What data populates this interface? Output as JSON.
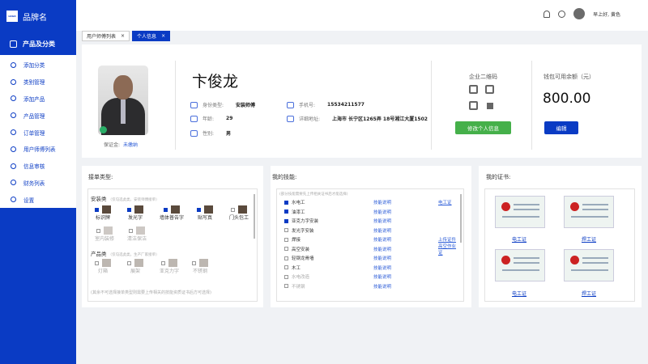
{
  "brand": {
    "logo": "LOGO",
    "name": "品牌名"
  },
  "sidebar": {
    "category": "产品及分类",
    "items": [
      {
        "label": "添加分类",
        "icon": "user-icon"
      },
      {
        "label": "类别管理",
        "icon": "list-icon"
      },
      {
        "label": "添加产品",
        "icon": "plus-icon"
      },
      {
        "label": "产品管理",
        "icon": "box-icon"
      },
      {
        "label": "订单管理",
        "icon": "order-icon"
      },
      {
        "label": "用户师傅列表",
        "icon": "users-icon"
      },
      {
        "label": "信息审核",
        "icon": "check-icon"
      },
      {
        "label": "财务列表",
        "icon": "finance-icon"
      },
      {
        "label": "设置",
        "icon": "gear-icon"
      }
    ]
  },
  "header": {
    "greeting": "早上好, 黄色"
  },
  "tabs": [
    {
      "label": "用户师傅列表"
    },
    {
      "label": "个人信息"
    }
  ],
  "profile": {
    "name": "卞俊龙",
    "guarantor_label": "保证金:",
    "guarantor_value": "未缴纳",
    "fields": {
      "type_label": "身份类型:",
      "type_value": "安装师傅",
      "age_label": "年龄:",
      "age_value": "29",
      "gender_label": "性别:",
      "gender_value": "男",
      "phone_label": "手机号:",
      "phone_value": "15534211577",
      "address_label": "详细地址:",
      "address_value": "上海市 长宁区1265弄 18号湘江大厦1502"
    },
    "qr_label": "企业二维码",
    "edit_info": "修改个人信息",
    "wallet_label": "钱包可用余额（元）",
    "balance": "800.00",
    "edit": "编辑"
  },
  "orders": {
    "title": "接单类型:",
    "install_label": "安装类",
    "install_hint": "（仅勾选此类，安装师傅接单）",
    "install_items": [
      {
        "label": "标识牌",
        "checked": true
      },
      {
        "label": "发光字",
        "checked": true
      },
      {
        "label": "墙体普告字",
        "checked": true
      },
      {
        "label": "贴写真",
        "checked": true
      },
      {
        "label": "门头包工",
        "checked": false
      },
      {
        "label": "室内装修",
        "checked": false
      },
      {
        "label": "清洁保洁",
        "checked": false
      }
    ],
    "product_label": "产品类",
    "product_hint": "（仅勾选此类，生产厂家接单）",
    "product_items": [
      {
        "label": "灯箱"
      },
      {
        "label": "展架"
      },
      {
        "label": "亚克力字"
      },
      {
        "label": "不锈钢"
      }
    ],
    "footer": "(其余不可选择接单类型则需要上传相关的技能资质证书后方可选择)"
  },
  "skills": {
    "title": "我的技能:",
    "hint": "(部分技能需要先上传相关证书后才能选择)",
    "rows": [
      {
        "label": "水电工",
        "checked": true,
        "link": "技能说明",
        "cert": "电工证"
      },
      {
        "label": "油漆工",
        "checked": true,
        "link": "技能说明",
        "cert": ""
      },
      {
        "label": "亚克力字安装",
        "checked": true,
        "link": "技能说明",
        "cert": ""
      },
      {
        "label": "发光字安装",
        "checked": false,
        "link": "技能说明",
        "cert": ""
      },
      {
        "label": "焊接",
        "checked": false,
        "link": "技能说明",
        "cert": "上传证件"
      },
      {
        "label": "高空安装",
        "checked": false,
        "link": "技能说明",
        "cert": "高空作业证"
      },
      {
        "label": "轻钢龙骨墙",
        "checked": false,
        "link": "技能说明",
        "cert": ""
      },
      {
        "label": "木工",
        "checked": false,
        "link": "技能说明",
        "cert": ""
      },
      {
        "label": "水电改造",
        "checked": false,
        "link": "技能说明",
        "cert": ""
      },
      {
        "label": "不锈钢",
        "checked": false,
        "link": "技能说明",
        "cert": ""
      }
    ]
  },
  "certs": {
    "title": "我的证书:",
    "items": [
      {
        "label": "电工证"
      },
      {
        "label": "焊工证"
      },
      {
        "label": "电工证"
      },
      {
        "label": "焊工证"
      }
    ]
  },
  "colors": {
    "primary": "#0a3bc4",
    "green": "#45b04a",
    "link": "#2a5bd7"
  }
}
